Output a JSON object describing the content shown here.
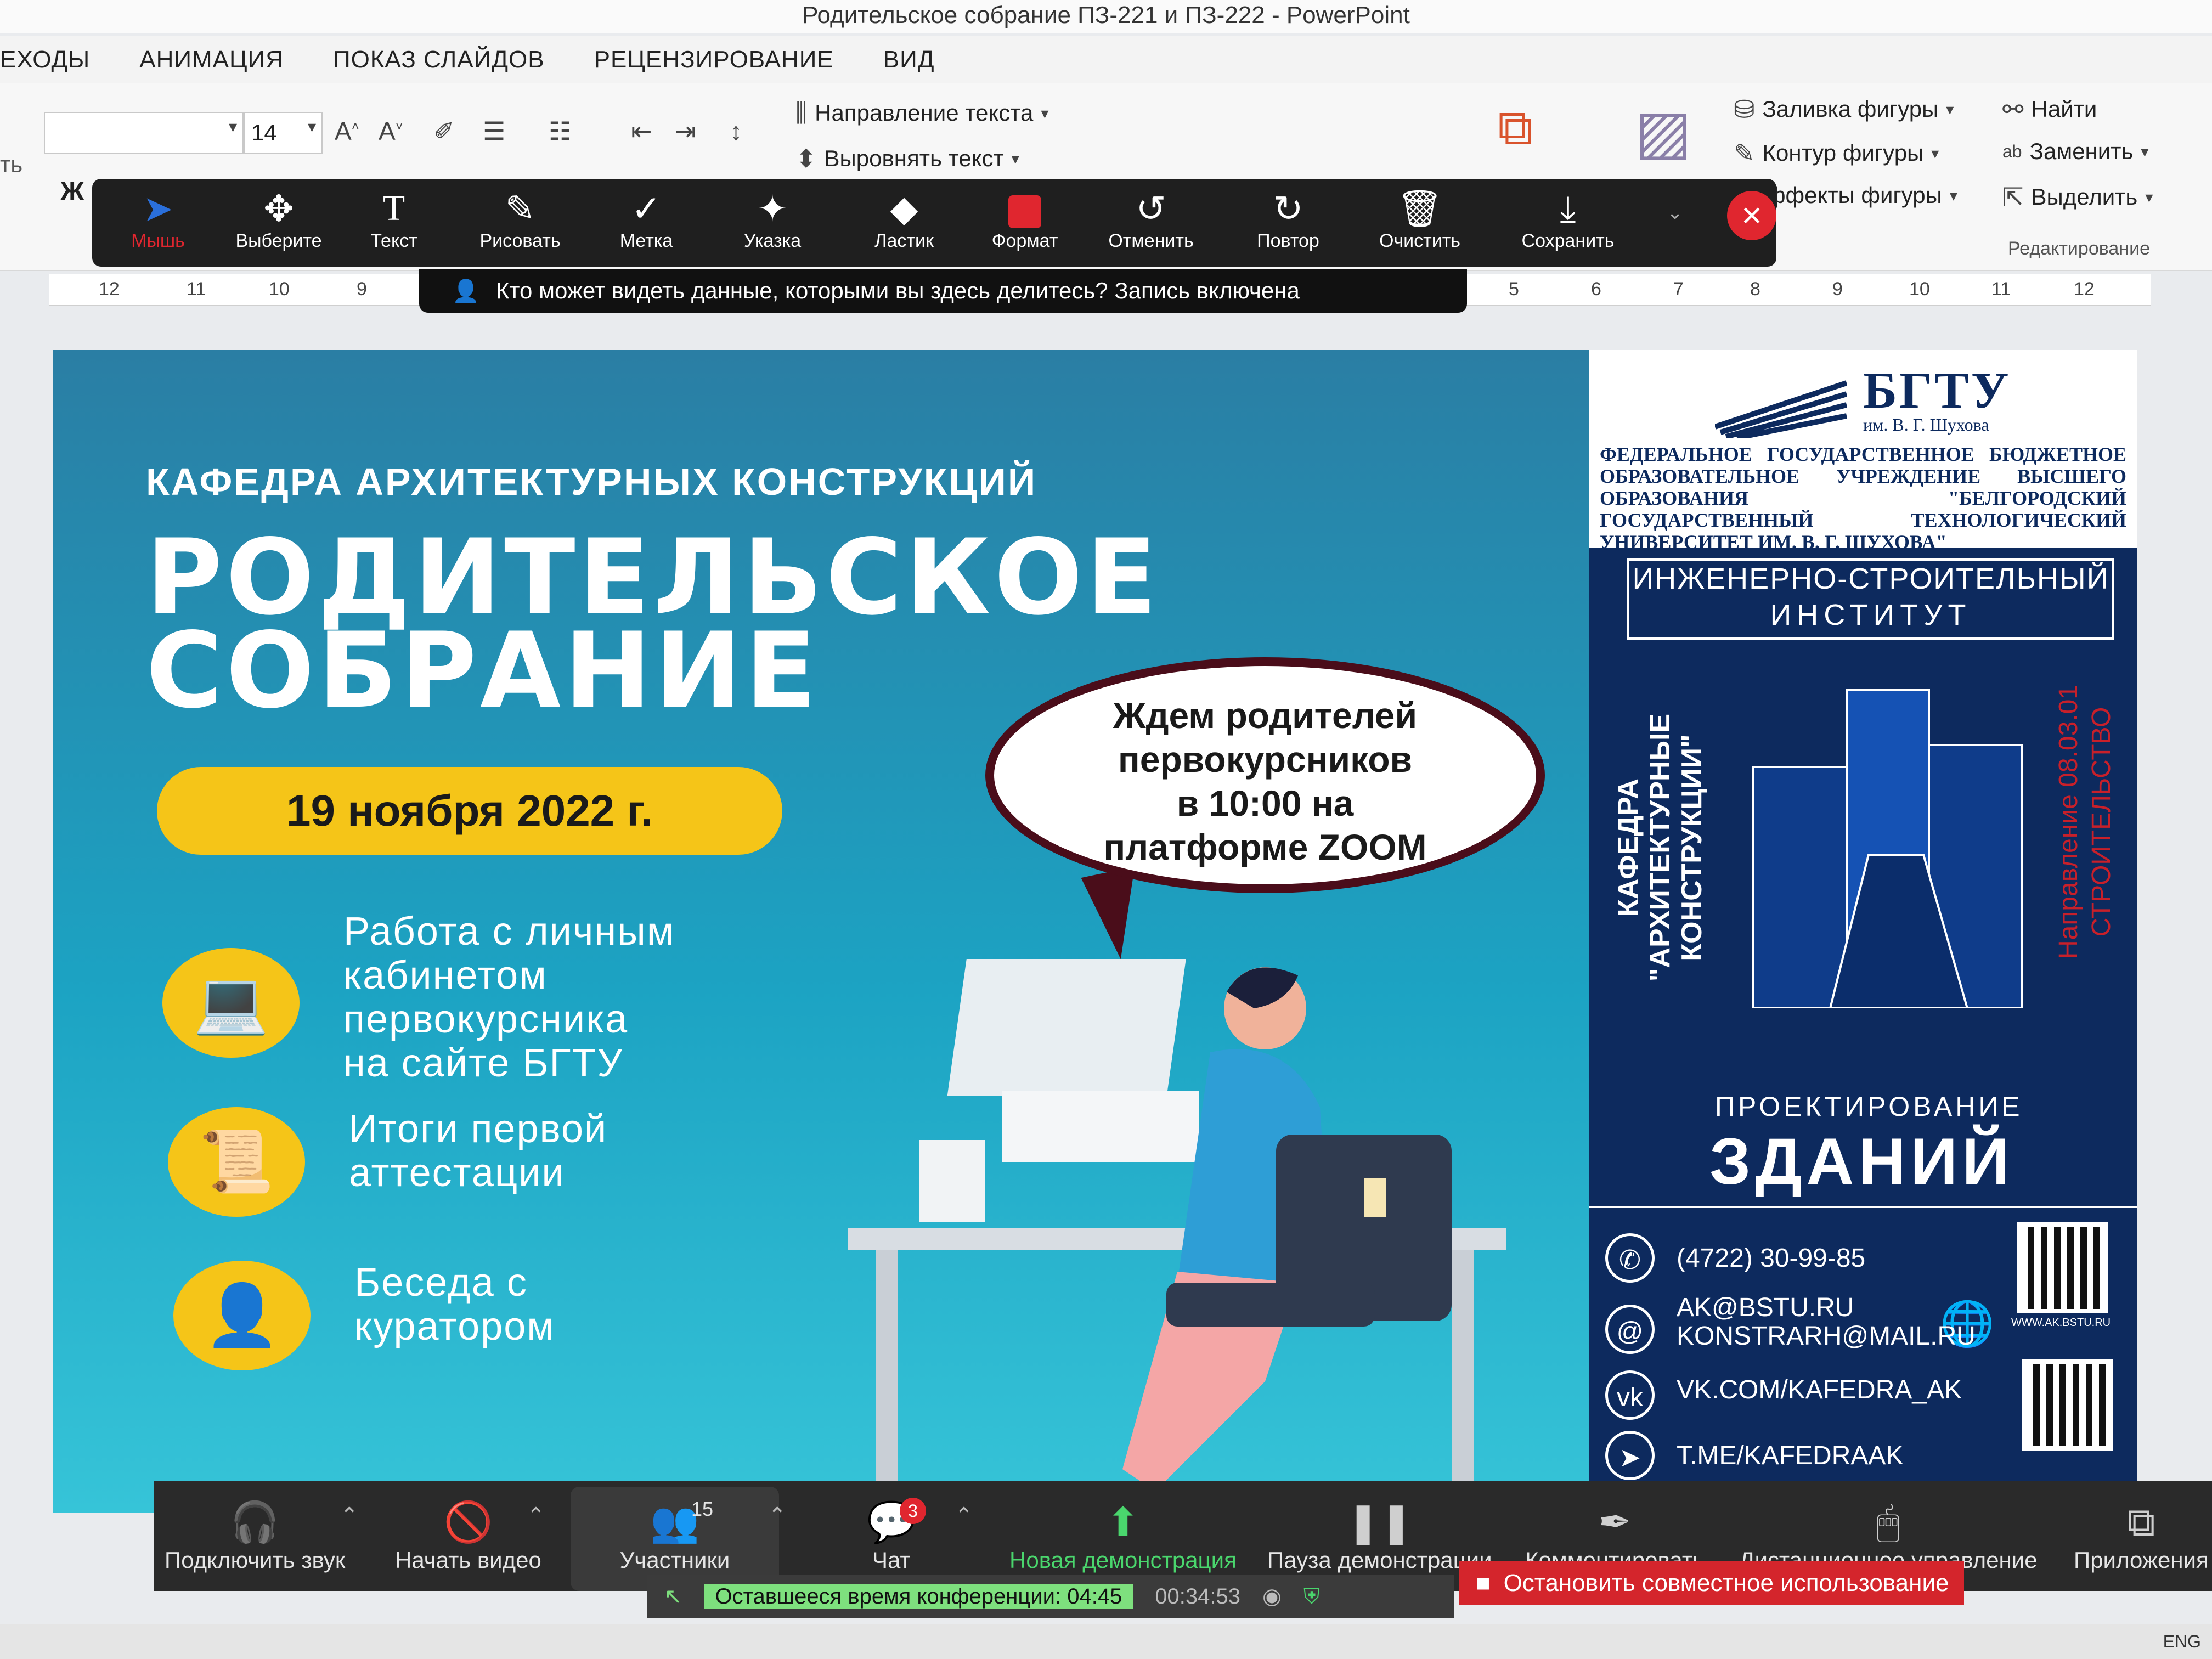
{
  "window": {
    "title": "Родительское собрание ПЗ-221 и ПЗ-222 - PowerPoint"
  },
  "ribbon": {
    "tabs": [
      "ЕХОДЫ",
      "АНИМАЦИЯ",
      "ПОКАЗ СЛАЙДОВ",
      "РЕЦЕНЗИРОВАНИЕ",
      "ВИД"
    ],
    "font_size": "14",
    "text_direction": "Направление текста",
    "align_text": "Выровнять текст",
    "shape_fill": "Заливка фигуры",
    "shape_outline": "Контур фигуры",
    "shape_effects": "ффекты фигуры",
    "find": "Найти",
    "replace": "Заменить",
    "select": "Выделить",
    "editing_group": "Редактирование",
    "bold_letter": "Ж",
    "left_edge_text": "ть"
  },
  "ruler": {
    "ticks_left": [
      "12",
      "11",
      "10",
      "9"
    ],
    "ticks_right": [
      "5",
      "6",
      "7",
      "8",
      "9",
      "10",
      "11",
      "12"
    ]
  },
  "annotation_toolbar": {
    "tools": [
      "Мышь",
      "Выберите",
      "Текст",
      "Рисовать",
      "Метка",
      "Указка",
      "Ластик",
      "Формат",
      "Отменить",
      "Повтор",
      "Очистить",
      "Сохранить"
    ],
    "banner": "Кто может видеть данные, которыми вы здесь делитесь? Запись включена",
    "accent": "#e0262f"
  },
  "slide": {
    "department": "КАФЕДРА АРХИТЕКТУРНЫХ КОНСТРУКЦИЙ",
    "title_line1": "РОДИТЕЛЬСКОЕ",
    "title_line2": "СОБРАНИЕ",
    "date": "19 ноября 2022 г.",
    "items": [
      {
        "icon": "laptop-icon",
        "text": [
          "Работа с личным",
          "кабинетом",
          "первокурсника",
          "на сайте БГТУ"
        ]
      },
      {
        "icon": "scroll-icon",
        "text": [
          "Итоги первой",
          "аттестации"
        ]
      },
      {
        "icon": "user-icon",
        "text": [
          "Беседа с",
          "куратором"
        ]
      }
    ],
    "bubble": [
      "Ждем родителей",
      "первокурсников",
      "в 10:00 на",
      "платформе ZOOM"
    ],
    "university": {
      "name": "БГТУ",
      "sub": "им. В. Г. Шухова",
      "desc": "ФЕДЕРАЛЬНОЕ ГОСУДАРСТВЕННОЕ БЮДЖЕТНОЕ ОБРАЗОВАТЕЛЬНОЕ УЧРЕЖДЕНИЕ ВЫСШЕГО ОБРАЗОВАНИЯ \"БЕЛГОРОДСКИЙ ГОСУДАРСТВЕННЫЙ ТЕХНОЛОГИЧЕСКИЙ УНИВЕРСИТЕТ ИМ. В. Г. ШУХОВА\"",
      "institute_line1": "ИНЖЕНЕРНО-СТРОИТЕЛЬНЫЙ",
      "institute_line2": "ИНСТИТУТ",
      "vertical_left": [
        "КАФЕДРА",
        "\"АРХИТЕКТУРНЫЕ",
        "КОНСТРУКЦИИ\""
      ],
      "vertical_right": [
        "Направление 08.03.01",
        "СТРОИТЕЛЬСТВО"
      ],
      "project_line1": "ПРОЕКТИРОВАНИЕ",
      "project_line2": "ЗДАНИЙ",
      "phone": "(4722) 30-99-85",
      "email1": "AK@BSTU.RU",
      "email2": "KONSTRARH@MAIL.RU",
      "vk": "VK.COM/KAFEDRA_AK",
      "telegram": "T.ME/KAFEDRAAK",
      "site": "WWW.AK.BSTU.RU"
    },
    "colors": {
      "navy": "#0d2a5e",
      "yellow": "#f5c518",
      "teal": "#1ca3c3",
      "bubble_border": "#4a0d1a"
    }
  },
  "zoom": {
    "buttons": [
      {
        "icon": "headphones-icon",
        "label": "Подключить звук"
      },
      {
        "icon": "video-off-icon",
        "label": "Начать видео"
      },
      {
        "icon": "participants-icon",
        "label": "Участники",
        "count": "15"
      },
      {
        "icon": "chat-icon",
        "label": "Чат",
        "badge": "3"
      },
      {
        "icon": "share-icon",
        "label": "Новая демонстрация"
      },
      {
        "icon": "pause-icon",
        "label": "Пауза демонстрации"
      },
      {
        "icon": "annotate-icon",
        "label": "Комментировать"
      },
      {
        "icon": "remote-control-icon",
        "label": "Дистанционное управление"
      },
      {
        "icon": "apps-icon",
        "label": "Приложения"
      }
    ],
    "remaining_time": "Оставшееся время конференции: 04:45",
    "elapsed": "00:34:53",
    "stop_share": "Остановить совместное использование",
    "lang": "ENG"
  }
}
